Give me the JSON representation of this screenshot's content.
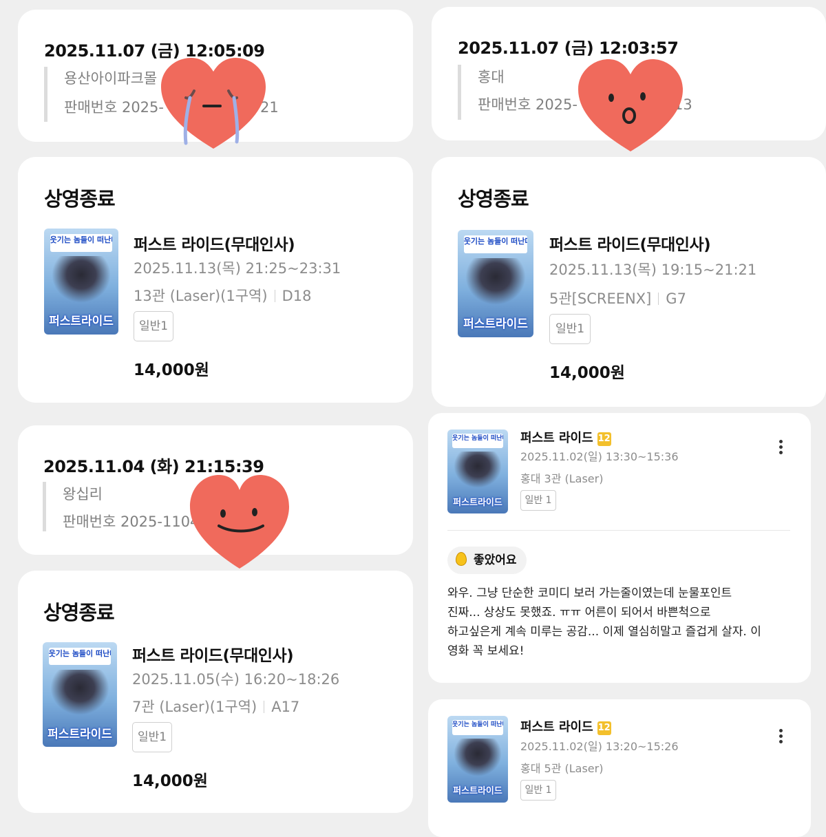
{
  "orders": [
    {
      "datetime": "2025.11.07 (금) 12:05:09",
      "theater": "용산아이파크몰",
      "sale_prefix": "판매번호 2025-",
      "sale_suffix": "21"
    },
    {
      "datetime": "2025.11.07 (금) 12:03:57",
      "theater": "홍대",
      "sale_prefix": "판매번호 2025-",
      "sale_suffix": "13"
    },
    {
      "datetime": "2025.11.04 (화) 21:15:39",
      "theater": "왕십리",
      "sale_prefix": "판매번호 2025-1104",
      "sale_suffix": ""
    }
  ],
  "ended": [
    {
      "status": "상영종료",
      "title": "퍼스트 라이드(무대인사)",
      "time": "2025.11.13(목) 21:25~23:31",
      "hall": "13관 (Laser)(1구역)",
      "seat": "D18",
      "ticket": "일반1",
      "price": "14,000원"
    },
    {
      "status": "상영종료",
      "title": "퍼스트 라이드(무대인사)",
      "time": "2025.11.13(목) 19:15~21:21",
      "hall": "5관[SCREENX]",
      "seat": "G7",
      "ticket": "일반1",
      "price": "14,000원"
    },
    {
      "status": "상영종료",
      "title": "퍼스트 라이드(무대인사)",
      "time": "2025.11.05(수) 16:20~18:26",
      "hall": "7관 (Laser)(1구역)",
      "seat": "A17",
      "ticket": "일반1",
      "price": "14,000원"
    }
  ],
  "poster": {
    "tagline": "웃기는 놈들이 떠난다!",
    "title": "퍼스트라이드"
  },
  "reviews": [
    {
      "title": "퍼스트 라이드",
      "age": "12",
      "time": "2025.11.02(일) 13:30~15:36",
      "place": "홍대 3관 (Laser)",
      "ticket": "일반 1",
      "rating": "좋았어요",
      "text": [
        "와우. 그냥 단순한 코미디 보러 가는줄이였는데 눈물포인트",
        "진짜... 상상도 못했죠. ㅠㅠ 어른이 되어서 바쁜척으로",
        "하고싶은게 계속 미루는 공감... 이제 열심히말고 즐겁게 살자. 이",
        "영화 꼭 보세요!"
      ]
    },
    {
      "title": "퍼스트 라이드",
      "age": "12",
      "time": "2025.11.02(일) 13:20~15:26",
      "place": "홍대 5관 (Laser)",
      "ticket": "일반 1"
    }
  ],
  "icons": {
    "kebab": "more-vertical-icon",
    "rating": "egg-icon",
    "stickers": [
      "crying-heart-sticker",
      "surprised-heart-sticker",
      "smiling-heart-sticker"
    ]
  },
  "colors": {
    "heart": "#f06a5c",
    "age_badge": "#f3c02c",
    "egg": "#f7c21b"
  }
}
